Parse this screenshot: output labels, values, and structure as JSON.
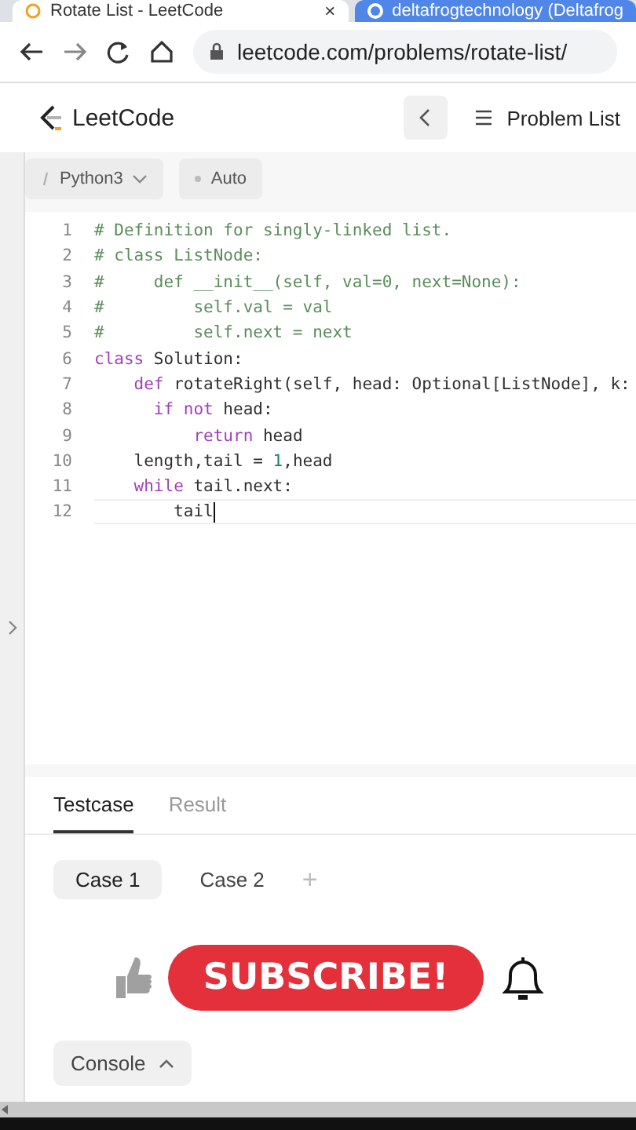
{
  "browser": {
    "tabs": [
      {
        "title": "Rotate List - LeetCode",
        "selected": true,
        "close": "×"
      },
      {
        "title": "deltafrogtechnology (Deltafrog",
        "selected": false
      }
    ],
    "address": "leetcode.com/problems/rotate-list/"
  },
  "header": {
    "logo": "LeetCode",
    "problem_list": "Problem List"
  },
  "toolbar": {
    "language": "Python3",
    "mode": "Auto"
  },
  "editor": {
    "lines": [
      {
        "number": "1",
        "cursor": false,
        "tokens": [
          {
            "kind": "comment",
            "text": "# Definition for singly-linked list."
          }
        ]
      },
      {
        "number": "2",
        "cursor": false,
        "tokens": [
          {
            "kind": "comment",
            "text": "# class ListNode:"
          }
        ]
      },
      {
        "number": "3",
        "cursor": false,
        "tokens": [
          {
            "kind": "comment",
            "text": "#     def __init__(self, val=0, next=None):"
          }
        ]
      },
      {
        "number": "4",
        "cursor": false,
        "tokens": [
          {
            "kind": "comment",
            "text": "#         self.val = val"
          }
        ]
      },
      {
        "number": "5",
        "cursor": false,
        "tokens": [
          {
            "kind": "comment",
            "text": "#         self.next = next"
          }
        ]
      },
      {
        "number": "6",
        "cursor": false,
        "tokens": [
          {
            "kind": "keyword",
            "text": "class"
          },
          {
            "kind": "plain",
            "text": " Solution:"
          }
        ]
      },
      {
        "number": "7",
        "cursor": false,
        "tokens": [
          {
            "kind": "keyword",
            "text": "    def"
          },
          {
            "kind": "plain",
            "text": " rotateRight(self, head: Optional[ListNode], k:"
          }
        ]
      },
      {
        "number": "8",
        "cursor": false,
        "tokens": [
          {
            "kind": "keyword",
            "text": "      if not"
          },
          {
            "kind": "plain",
            "text": " head:"
          }
        ]
      },
      {
        "number": "9",
        "cursor": false,
        "tokens": [
          {
            "kind": "keyword",
            "text": "          return"
          },
          {
            "kind": "plain",
            "text": " head"
          }
        ]
      },
      {
        "number": "10",
        "cursor": false,
        "tokens": [
          {
            "kind": "plain",
            "text": "    length,tail = "
          },
          {
            "kind": "number",
            "text": "1"
          },
          {
            "kind": "plain",
            "text": ",head"
          }
        ]
      },
      {
        "number": "11",
        "cursor": false,
        "tokens": [
          {
            "kind": "keyword",
            "text": "    while"
          },
          {
            "kind": "plain",
            "text": " tail.next:"
          }
        ]
      },
      {
        "number": "12",
        "cursor": true,
        "tokens": [
          {
            "kind": "plain",
            "text": "        tail"
          }
        ]
      }
    ]
  },
  "panel": {
    "tabs": [
      {
        "label": "Testcase",
        "selected": true
      },
      {
        "label": "Result",
        "selected": false
      }
    ],
    "cases": [
      {
        "label": "Case 1",
        "selected": true
      },
      {
        "label": "Case 2",
        "selected": false
      }
    ],
    "add": "+",
    "console": "Console"
  },
  "overlay": {
    "subscribe": "SUBSCRIBE!"
  }
}
